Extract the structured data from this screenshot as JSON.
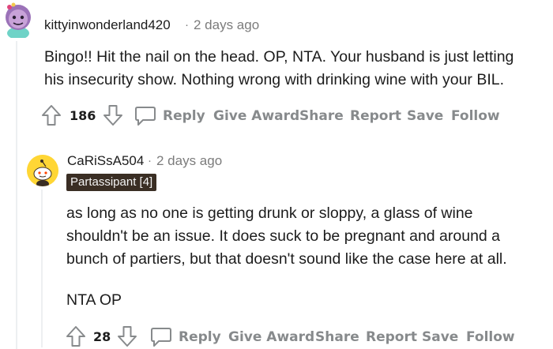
{
  "comment1": {
    "username": "kittyinwonderland420",
    "separator": "·",
    "time": "2 days ago",
    "body_line1": "Bingo!! Hit the nail on the head. OP, NTA. Your husband is just letting",
    "body_line2": "his insecurity show. Nothing wrong with drinking wine with your BIL.",
    "votes": "186",
    "actions": {
      "reply": "Reply",
      "give_award": "Give Award",
      "share": "Share",
      "report": "Report",
      "save": "Save",
      "follow": "Follow"
    }
  },
  "comment2": {
    "username": "CaRiSsA504",
    "separator": "·",
    "time": "2 days ago",
    "flair": "Partassipant [4]",
    "body_line1": "as long as no one is getting drunk or sloppy, a glass of wine",
    "body_line2": "shouldn't be an issue. It does suck to be pregnant and around a",
    "body_line3": "bunch of partiers, but that doesn't sound like the case here at all.",
    "body_line4": "NTA OP",
    "votes": "28",
    "actions": {
      "reply": "Reply",
      "give_award": "Give Award",
      "share": "Share",
      "report": "Report",
      "save": "Save",
      "follow": "Follow"
    }
  },
  "icons": {
    "upvote": "upvote-icon",
    "downvote": "downvote-icon",
    "comment": "comment-bubble-icon"
  },
  "colors": {
    "action_gray": "#878a8c",
    "flair_bg": "#3a2e24",
    "avatar2_bg": "#ffd635"
  }
}
